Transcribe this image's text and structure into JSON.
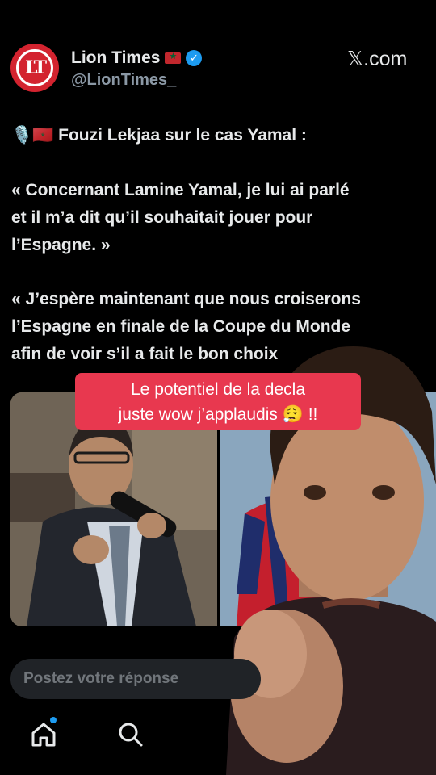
{
  "header": {
    "account_name": "Lion Times",
    "handle": "@LionTimes_",
    "logo_text": "LT",
    "brand": "𝕏.com"
  },
  "tweet": {
    "line1": "🎙️🇲🇦 Fouzi Lekjaa sur le cas Yamal :",
    "quote1": "« Concernant Lamine Yamal, je lui ai parlé\net il m’a dit qu’il souhaitait jouer pour\nl’Espagne. »",
    "quote2": "« J’espère maintenant que nous croiserons\nl’Espagne en finale de la Coupe du Monde\nafin de voir s’il a fait le bon choix"
  },
  "caption": {
    "line1": "Le potentiel de la decla",
    "line2": "juste wow j’applaudis 😮‍💨 !!"
  },
  "reply": {
    "placeholder": "Postez votre réponse"
  },
  "nav": {
    "items": [
      "home-icon",
      "search-icon"
    ]
  },
  "colors": {
    "accent": "#1d9bf0",
    "brand_red": "#d3232f",
    "caption_bg": "#e8384f"
  }
}
